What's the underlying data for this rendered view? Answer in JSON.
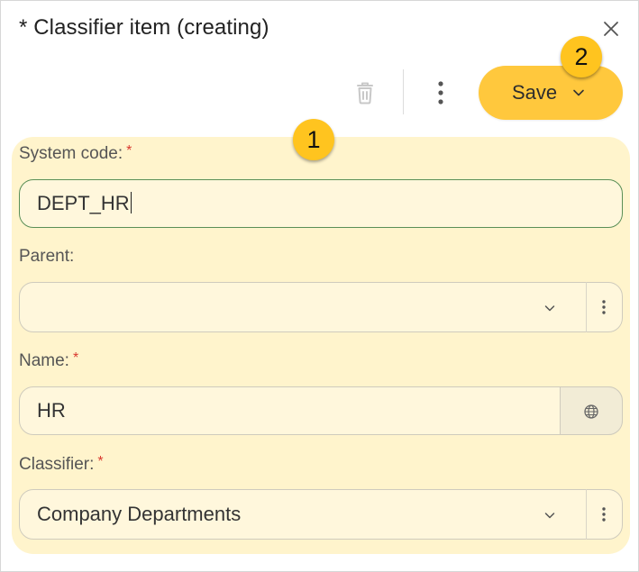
{
  "dialog": {
    "title": "* Classifier item (creating)"
  },
  "toolbar": {
    "save_label": "Save"
  },
  "badges": {
    "first": "1",
    "second": "2"
  },
  "form": {
    "system_code": {
      "label": "System code:",
      "required_mark": "*",
      "value": "DEPT_HR"
    },
    "parent": {
      "label": "Parent:",
      "value": ""
    },
    "name": {
      "label": "Name:",
      "required_mark": "*",
      "value": "HR"
    },
    "classifier": {
      "label": "Classifier:",
      "required_mark": "*",
      "value": "Company Departments"
    }
  },
  "colors": {
    "accent": "#ffc83d",
    "highlight_area": "#fff4cc",
    "required": "#d9392f",
    "focus_border": "#5a8f57"
  },
  "icons": [
    "close-icon",
    "trash-icon",
    "more-vertical-icon",
    "chevron-down-icon",
    "globe-icon"
  ]
}
